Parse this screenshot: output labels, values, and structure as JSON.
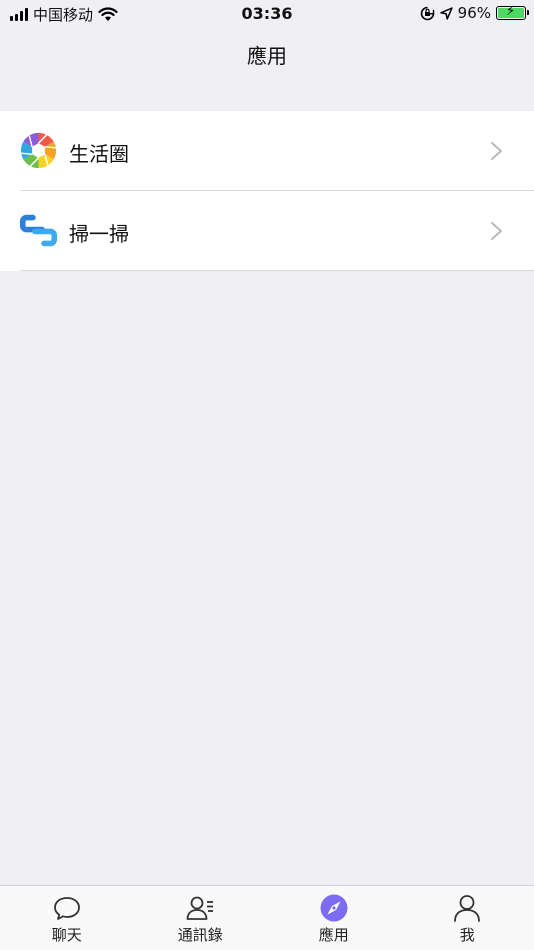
{
  "status_bar": {
    "carrier": "中国移动",
    "time": "03:36",
    "battery": "96%",
    "signal_icon": "signal-bars-icon",
    "wifi_icon": "wifi-icon",
    "lock_icon": "orientation-lock-icon",
    "location_icon": "location-arrow-icon",
    "battery_icon": "battery-charging-icon"
  },
  "nav": {
    "title": "應用"
  },
  "list": {
    "items": [
      {
        "label": "生活圈",
        "icon": "aperture-icon"
      },
      {
        "label": "掃一掃",
        "icon": "scan-icon"
      }
    ]
  },
  "tabs": [
    {
      "label": "聊天",
      "icon": "chat-bubble-icon",
      "active": false
    },
    {
      "label": "通訊錄",
      "icon": "contacts-icon",
      "active": false
    },
    {
      "label": "應用",
      "icon": "compass-icon",
      "active": true
    },
    {
      "label": "我",
      "icon": "person-icon",
      "active": false
    }
  ],
  "colors": {
    "background": "#efeff4",
    "accent": "#7b6cf2",
    "battery_fill": "#4cd964",
    "scan_icon": "#2d7fd8"
  }
}
